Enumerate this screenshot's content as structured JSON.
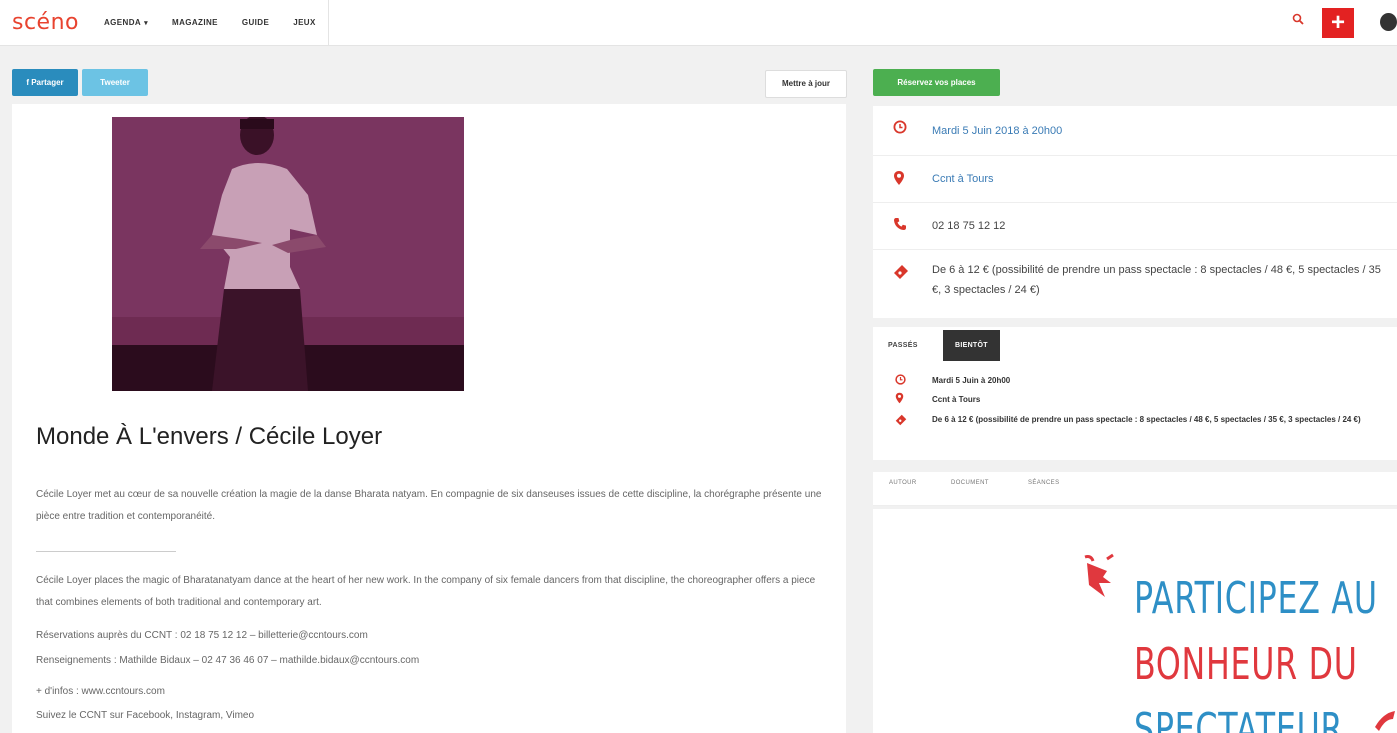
{
  "header": {
    "logo": "scéno",
    "nav": [
      {
        "label": "AGENDA",
        "has_caret": true
      },
      {
        "label": "MAGAZINE"
      },
      {
        "label": "GUIDE"
      },
      {
        "label": "JEUX"
      }
    ],
    "caret": "▾",
    "search_icon": "search-icon",
    "plus_label": "+",
    "globe_icon": "globe-icon",
    "accent": "#e8432f"
  },
  "share": {
    "facebook_label": "f Partager",
    "twitter_label": "Tweeter",
    "update_label": "Mettre à jour"
  },
  "event": {
    "title": "Monde À L'envers / Cécile Loyer",
    "description_fr": "Cécile Loyer met au cœur de sa nouvelle création la magie de la danse Bharata natyam. En compagnie de six danseuses issues de cette discipline, la chorégraphe présente une pièce entre tradition et contemporanéité.",
    "description_en": "Cécile Loyer places the magic of Bharatanatyam dance at the heart of her new work. In the company of six female dancers from that discipline, the choreographer offers a piece that combines elements of both traditional and contemporary art.",
    "reservations": "Réservations auprès du CCNT : 02 18 75 12 12 – billetterie@ccntours.com",
    "renseignements": "Renseignements : Mathilde Bidaux – 02 47 36 46 07 – mathilde.bidaux@ccntours.com",
    "more_info": "+ d'infos : www.ccntours.com",
    "follow": "Suivez le CCNT sur Facebook, Instagram, Vimeo"
  },
  "sidebar": {
    "reserve_label": "Réservez vos places",
    "date": "Mardi 5 Juin 2018 à 20h00",
    "venue": "Ccnt à Tours",
    "phone": "02 18 75 12 12",
    "price": "De 6 à 12 € (possibilité de prendre un pass spectacle : 8 spectacles / 48 €, 5 spectacles / 35 €, 3 spectacles / 24 €)",
    "tabs": {
      "past": "PASSÉS",
      "future": "BIENTÔT"
    },
    "session": {
      "date": "Mardi 5 Juin à 20h00",
      "venue": "Ccnt à Tours",
      "price": "De 6 à 12 € (possibilité de prendre un pass spectacle : 8 spectacles / 48 €, 5 spectacles / 35 €, 3 spectacles / 24 €)"
    },
    "tabs2": [
      "AUTOUR",
      "DOCUMENT",
      "SÉANCES"
    ],
    "ad": {
      "line1": "PARTICIPEZ AU",
      "line2": "BONHEUR DU",
      "line3": "SPECTATEUR"
    }
  },
  "colors": {
    "accent_red": "#d9372b",
    "green": "#4caf50",
    "facebook": "#2a8cbd",
    "twitter": "#6cc3e4",
    "link": "#3a7bb5"
  }
}
